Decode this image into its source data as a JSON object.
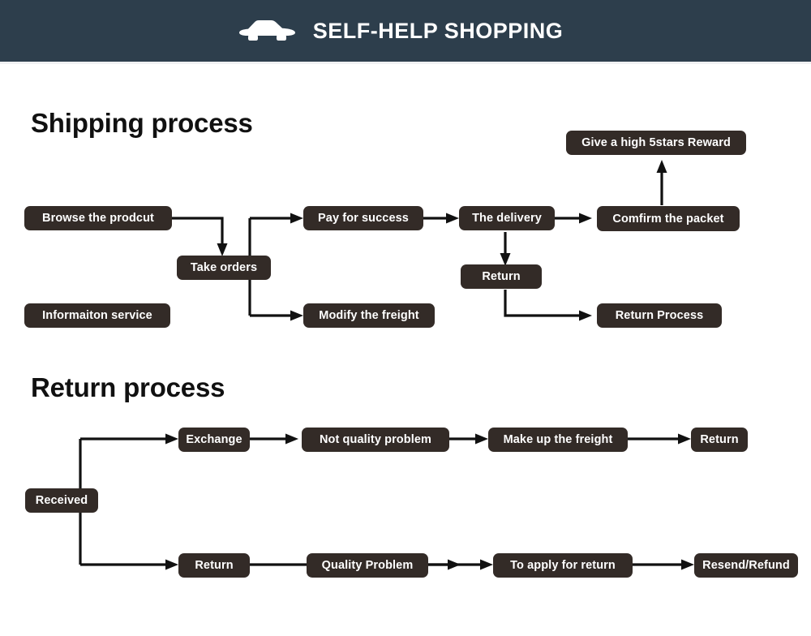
{
  "header": {
    "title": "SELF-HELP SHOPPING",
    "icon": "car-icon",
    "background_color": "#2d3e4c",
    "text_color": "#ffffff"
  },
  "theme": {
    "node_fill": "#332b27",
    "node_text": "#ffffff",
    "wire_color": "#111111",
    "page_background": "#ffffff"
  },
  "sections": [
    {
      "id": "shipping",
      "title": "Shipping process",
      "nodes": [
        {
          "id": "browse",
          "label": "Browse the prodcut"
        },
        {
          "id": "informaiton",
          "label": "Informaiton service"
        },
        {
          "id": "take-orders",
          "label": "Take orders"
        },
        {
          "id": "pay",
          "label": "Pay for success"
        },
        {
          "id": "modify",
          "label": "Modify the freight"
        },
        {
          "id": "delivery",
          "label": "The delivery"
        },
        {
          "id": "return",
          "label": "Return"
        },
        {
          "id": "confirm",
          "label": "Comfirm the packet"
        },
        {
          "id": "reward",
          "label": "Give a high 5stars Reward"
        },
        {
          "id": "return-process",
          "label": "Return Process"
        }
      ]
    },
    {
      "id": "return",
      "title": "Return process",
      "nodes": [
        {
          "id": "received",
          "label": "Received"
        },
        {
          "id": "exchange",
          "label": "Exchange"
        },
        {
          "id": "not-quality",
          "label": "Not quality problem"
        },
        {
          "id": "make-up",
          "label": "Make up the freight"
        },
        {
          "id": "return-top",
          "label": "Return"
        },
        {
          "id": "return-bottom",
          "label": "Return"
        },
        {
          "id": "quality",
          "label": "Quality Problem"
        },
        {
          "id": "apply",
          "label": "To apply for return"
        },
        {
          "id": "resend",
          "label": "Resend/Refund"
        }
      ]
    }
  ]
}
